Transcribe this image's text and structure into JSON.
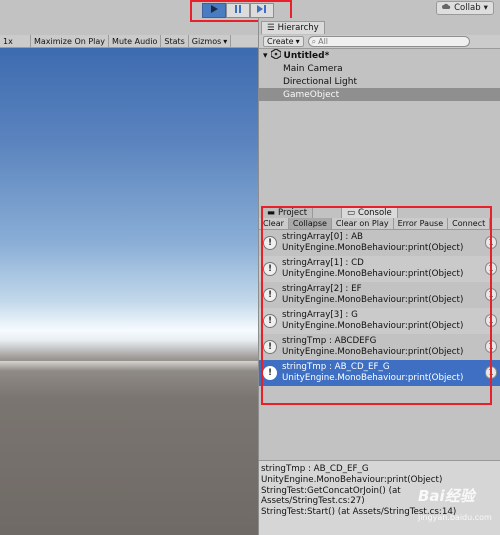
{
  "toolbar": {
    "collab_label": "Collab"
  },
  "game_toolbar": {
    "scale": "1x",
    "buttons": [
      "Maximize On Play",
      "Mute Audio",
      "Stats",
      "Gizmos"
    ]
  },
  "hierarchy": {
    "tab_label": "Hierarchy",
    "create_label": "Create",
    "search_placeholder": "All",
    "scene_name": "Untitled*",
    "items": [
      "Main Camera",
      "Directional Light",
      "GameObject"
    ]
  },
  "console": {
    "project_tab": "Project",
    "console_tab": "Console",
    "toolbar": [
      "Clear",
      "Collapse",
      "Clear on Play",
      "Error Pause",
      "Connect"
    ],
    "logs": [
      {
        "line1": "stringArray[0] : AB",
        "line2": "UnityEngine.MonoBehaviour:print(Object)",
        "count": "1"
      },
      {
        "line1": "stringArray[1] : CD",
        "line2": "UnityEngine.MonoBehaviour:print(Object)",
        "count": "1"
      },
      {
        "line1": "stringArray[2] : EF",
        "line2": "UnityEngine.MonoBehaviour:print(Object)",
        "count": "1"
      },
      {
        "line1": "stringArray[3] : G",
        "line2": "UnityEngine.MonoBehaviour:print(Object)",
        "count": "1"
      },
      {
        "line1": "stringTmp : ABCDEFG",
        "line2": "UnityEngine.MonoBehaviour:print(Object)",
        "count": "1"
      },
      {
        "line1": "stringTmp : AB_CD_EF_G",
        "line2": "UnityEngine.MonoBehaviour:print(Object)",
        "count": "1"
      }
    ],
    "detail": [
      "stringTmp : AB_CD_EF_G",
      "UnityEngine.MonoBehaviour:print(Object)",
      "StringTest:GetConcatOrJoin() (at",
      "Assets/StringTest.cs:27)",
      "StringTest:Start() (at Assets/StringTest.cs:14)"
    ]
  },
  "watermark": {
    "brand": "Bai经验",
    "url": "jingyan.baidu.com"
  },
  "colors": {
    "highlight_box": "#e8202a",
    "play_active": "#4a7cc2",
    "selected_log": "#3e6fc2"
  }
}
